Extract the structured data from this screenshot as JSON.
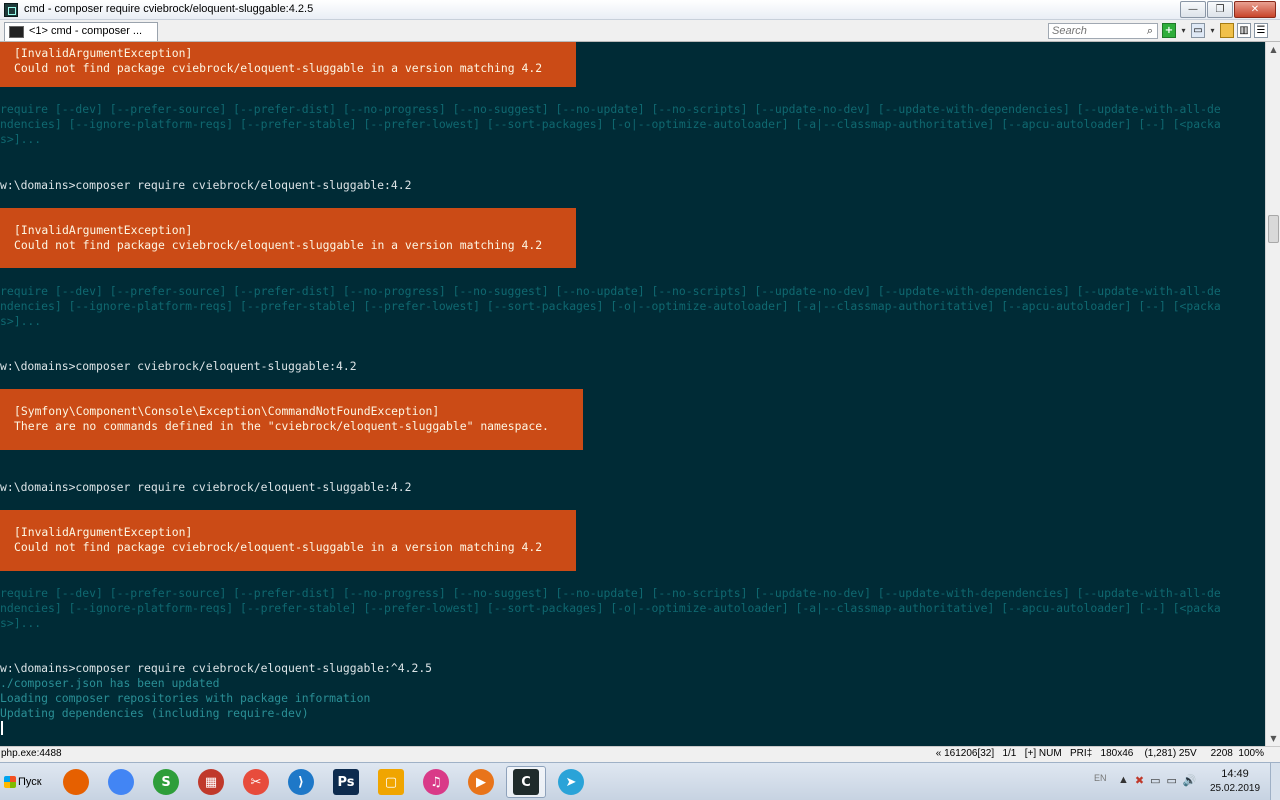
{
  "window": {
    "title": "cmd - composer  require cviebrock/eloquent-sluggable:4.2.5",
    "buttons": {
      "minimize": "—",
      "maximize": "❐",
      "close": "✕"
    }
  },
  "tabs": [
    {
      "label": "<1> cmd - composer ..."
    }
  ],
  "search": {
    "placeholder": "Search"
  },
  "toolbar": {
    "add": "+",
    "dropdown": "▾",
    "layout": "▭",
    "lock": "🔒",
    "view": "▥",
    "menu": "☰"
  },
  "console": {
    "err1": {
      "title": "[InvalidArgumentException]",
      "msg": "Could not find package cviebrock/eloquent-sluggable in a version matching 4.2"
    },
    "usage1": [
      "require [--dev] [--prefer-source] [--prefer-dist] [--no-progress] [--no-suggest] [--no-update] [--no-scripts] [--update-no-dev] [--update-with-dependencies] [--update-with-all-de",
      "ndencies] [--ignore-platform-reqs] [--prefer-stable] [--prefer-lowest] [--sort-packages] [-o|--optimize-autoloader] [-a|--classmap-authoritative] [--apcu-autoloader] [--] [<packa",
      "s>]..."
    ],
    "cmd1": "w:\\domains>composer require cviebrock/eloquent-sluggable:4.2",
    "err2": {
      "title": "[InvalidArgumentException]",
      "msg": "Could not find package cviebrock/eloquent-sluggable in a version matching 4.2"
    },
    "usage2": [
      "require [--dev] [--prefer-source] [--prefer-dist] [--no-progress] [--no-suggest] [--no-update] [--no-scripts] [--update-no-dev] [--update-with-dependencies] [--update-with-all-de",
      "ndencies] [--ignore-platform-reqs] [--prefer-stable] [--prefer-lowest] [--sort-packages] [-o|--optimize-autoloader] [-a|--classmap-authoritative] [--apcu-autoloader] [--] [<packa",
      "s>]..."
    ],
    "cmd2": "w:\\domains>composer cviebrock/eloquent-sluggable:4.2",
    "err3": {
      "title": "[Symfony\\Component\\Console\\Exception\\CommandNotFoundException]",
      "msg": "There are no commands defined in the \"cviebrock/eloquent-sluggable\" namespace."
    },
    "cmd3": "w:\\domains>composer require cviebrock/eloquent-sluggable:4.2",
    "err4": {
      "title": "[InvalidArgumentException]",
      "msg": "Could not find package cviebrock/eloquent-sluggable in a version matching 4.2"
    },
    "usage3": [
      "require [--dev] [--prefer-source] [--prefer-dist] [--no-progress] [--no-suggest] [--no-update] [--no-scripts] [--update-no-dev] [--update-with-dependencies] [--update-with-all-de",
      "ndencies] [--ignore-platform-reqs] [--prefer-stable] [--prefer-lowest] [--sort-packages] [-o|--optimize-autoloader] [-a|--classmap-authoritative] [--apcu-autoloader] [--] [<packa",
      "s>]..."
    ],
    "cmd4": "w:\\domains>composer require cviebrock/eloquent-sluggable:^4.2.5",
    "out": [
      "./composer.json has been updated",
      "Loading composer repositories with package information",
      "Updating dependencies (including require-dev)"
    ]
  },
  "statusbar": {
    "process": "php.exe:4488",
    "info": "« 161206[32]   1/1   [+] NUM   PRI‡   180x46    (1,281) 25V     2208  100%"
  },
  "taskbar": {
    "start_label": "Пуск",
    "apps": [
      {
        "name": "firefox",
        "glyph": "",
        "color": "#e66000"
      },
      {
        "name": "chrome",
        "glyph": "",
        "color": "#4285f4"
      },
      {
        "name": "sublime",
        "glyph": "S",
        "color": "#2e9e3a"
      },
      {
        "name": "app-grid",
        "glyph": "▦",
        "color": "#c0392b"
      },
      {
        "name": "tools",
        "glyph": "✂",
        "color": "#e74c3c"
      },
      {
        "name": "vscode",
        "glyph": "⟩",
        "color": "#1e78c8"
      },
      {
        "name": "photoshop",
        "glyph": "Ps",
        "color": "#0d2b4e"
      },
      {
        "name": "file-manager",
        "glyph": "▢",
        "color": "#f0a500"
      },
      {
        "name": "itunes",
        "glyph": "♫",
        "color": "#d93a88"
      },
      {
        "name": "media-player",
        "glyph": "▶",
        "color": "#e8741a"
      },
      {
        "name": "conemu",
        "glyph": "C",
        "color": "#1f2b2b"
      },
      {
        "name": "telegram",
        "glyph": "➤",
        "color": "#2aa3d8"
      }
    ],
    "tray": {
      "lang": "EN",
      "time": "14:49",
      "date": "25.02.2019",
      "icons": [
        "▲",
        "✖",
        "▭",
        "▭",
        "🔊"
      ]
    }
  }
}
